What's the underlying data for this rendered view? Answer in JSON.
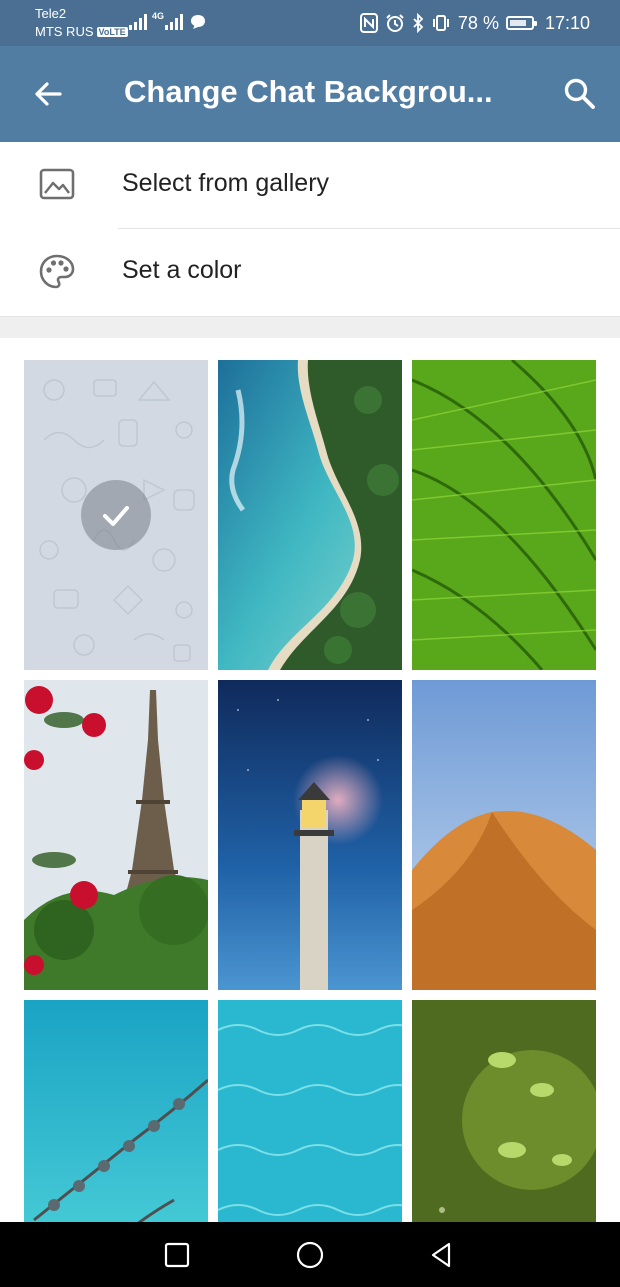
{
  "status_bar": {
    "carrier_1": "Tele2",
    "carrier_2": "MTS RUS",
    "volte_badge": "VoLTE",
    "network_type": "4G",
    "battery_percent": "78 %",
    "battery_level": 0.78,
    "time": "17:10"
  },
  "app_bar": {
    "title": "Change Chat Backgrou...",
    "back_icon": "arrow-left-icon",
    "search_icon": "search-icon"
  },
  "menu": {
    "items": [
      {
        "label": "Select from gallery",
        "icon": "image-icon"
      },
      {
        "label": "Set a color",
        "icon": "palette-icon"
      }
    ]
  },
  "wallpapers": [
    {
      "name": "default-pattern",
      "selected": true
    },
    {
      "name": "aerial-coastline",
      "selected": false
    },
    {
      "name": "green-fern",
      "selected": false
    },
    {
      "name": "eiffel-tower",
      "selected": false
    },
    {
      "name": "lighthouse",
      "selected": false
    },
    {
      "name": "desert-dune",
      "selected": false
    },
    {
      "name": "lagoon-villas",
      "selected": false
    },
    {
      "name": "turquoise-water",
      "selected": false
    },
    {
      "name": "green-leaves-bokeh",
      "selected": false
    }
  ],
  "nav_bar": {
    "recents_icon": "square-icon",
    "home_icon": "circle-icon",
    "back_icon": "triangle-back-icon"
  },
  "colors": {
    "status_bar": "#4a6f93",
    "app_bar": "#527da3",
    "nav_bar": "#000000"
  }
}
